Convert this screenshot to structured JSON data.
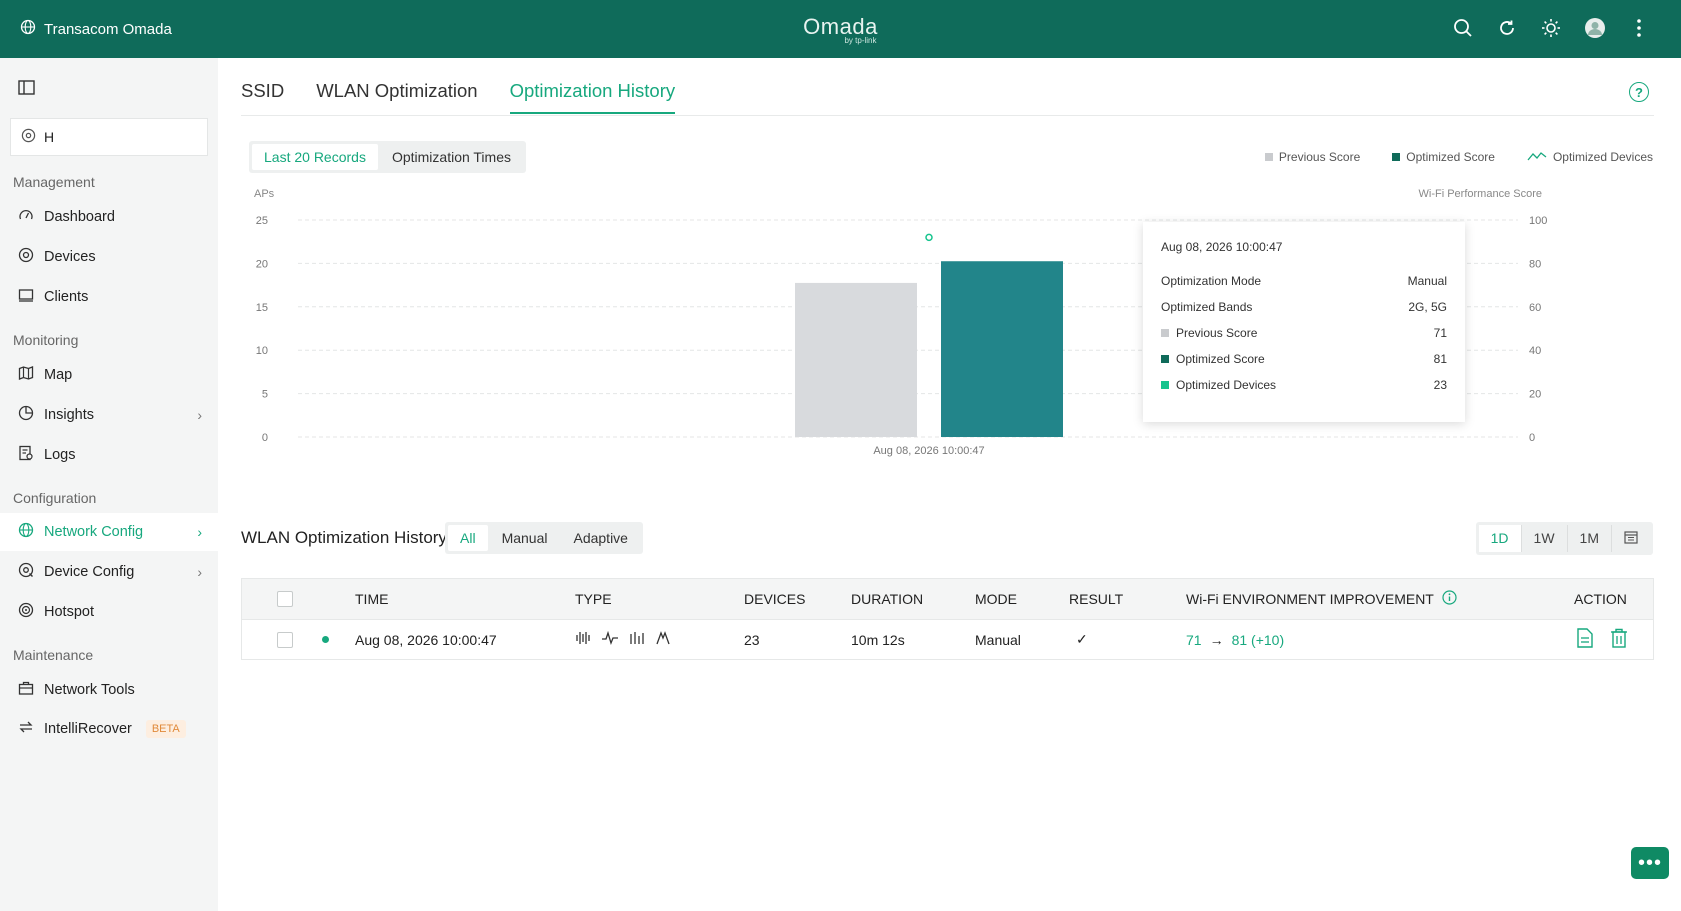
{
  "header": {
    "org_name": "Transacom Omada",
    "logo": "Omada",
    "logo_sub": "by tp-link",
    "icons": [
      "search-icon",
      "refresh-icon",
      "theme-icon",
      "avatar",
      "more-icon"
    ]
  },
  "sidebar": {
    "site_value": "H",
    "sections": {
      "management": "Management",
      "monitoring": "Monitoring",
      "configuration": "Configuration",
      "maintenance": "Maintenance"
    },
    "items": {
      "dashboard": "Dashboard",
      "devices": "Devices",
      "clients": "Clients",
      "map": "Map",
      "insights": "Insights",
      "logs": "Logs",
      "network_config": "Network Config",
      "device_config": "Device Config",
      "hotspot": "Hotspot",
      "network_tools": "Network Tools",
      "intellirecover": "IntelliRecover",
      "beta": "BETA"
    }
  },
  "tabs": [
    "SSID",
    "WLAN Optimization",
    "Optimization History"
  ],
  "active_tab": "Optimization History",
  "record_toggle": [
    "Last 20 Records",
    "Optimization Times"
  ],
  "legend": {
    "previous": "Previous Score",
    "optimized": "Optimized Score",
    "devices": "Optimized Devices"
  },
  "colors": {
    "brand": "#0f6b5a",
    "accent": "#17a87e",
    "previous_bar": "#d8dadd",
    "optimized_bar": "#22858a"
  },
  "chart_data": {
    "type": "bar",
    "categories": [
      "Aug 08, 2026 10:00:47"
    ],
    "series": [
      {
        "name": "Previous Score",
        "values": [
          71
        ],
        "axis": "right"
      },
      {
        "name": "Optimized Score",
        "values": [
          81
        ],
        "axis": "right"
      },
      {
        "name": "Optimized Devices",
        "values": [
          23
        ],
        "axis": "left",
        "kind": "line"
      }
    ],
    "ylabel_left": "APs",
    "ylabel_right": "Wi-Fi Performance Score",
    "ylim_left": [
      0,
      25
    ],
    "yticks_left": [
      "25",
      "20",
      "15",
      "10",
      "5",
      "0"
    ],
    "ylim_right": [
      0,
      100
    ],
    "yticks_right": [
      "100",
      "80",
      "60",
      "40",
      "20",
      "0"
    ],
    "grid": true
  },
  "tooltip": {
    "timestamp": "Aug 08, 2026 10:00:47",
    "mode_label": "Optimization Mode",
    "mode_value": "Manual",
    "bands_label": "Optimized Bands",
    "bands_value": "2G, 5G",
    "prev_label": "Previous Score",
    "prev_value": "71",
    "opt_label": "Optimized Score",
    "opt_value": "81",
    "dev_label": "Optimized Devices",
    "dev_value": "23"
  },
  "history": {
    "title": "WLAN Optimization History",
    "filters": [
      "All",
      "Manual",
      "Adaptive"
    ],
    "ranges": [
      "1D",
      "1W",
      "1M"
    ],
    "columns": [
      "TIME",
      "TYPE",
      "DEVICES",
      "DURATION",
      "MODE",
      "RESULT",
      "Wi-Fi ENVIRONMENT IMPROVEMENT",
      "ACTION"
    ],
    "rows": [
      {
        "time": "Aug 08, 2026 10:00:47",
        "devices": "23",
        "duration": "10m 12s",
        "mode": "Manual",
        "result": "✓",
        "improvement_from": "71",
        "improvement_arrow": "→",
        "improvement_to": "81 (+10)"
      }
    ]
  }
}
